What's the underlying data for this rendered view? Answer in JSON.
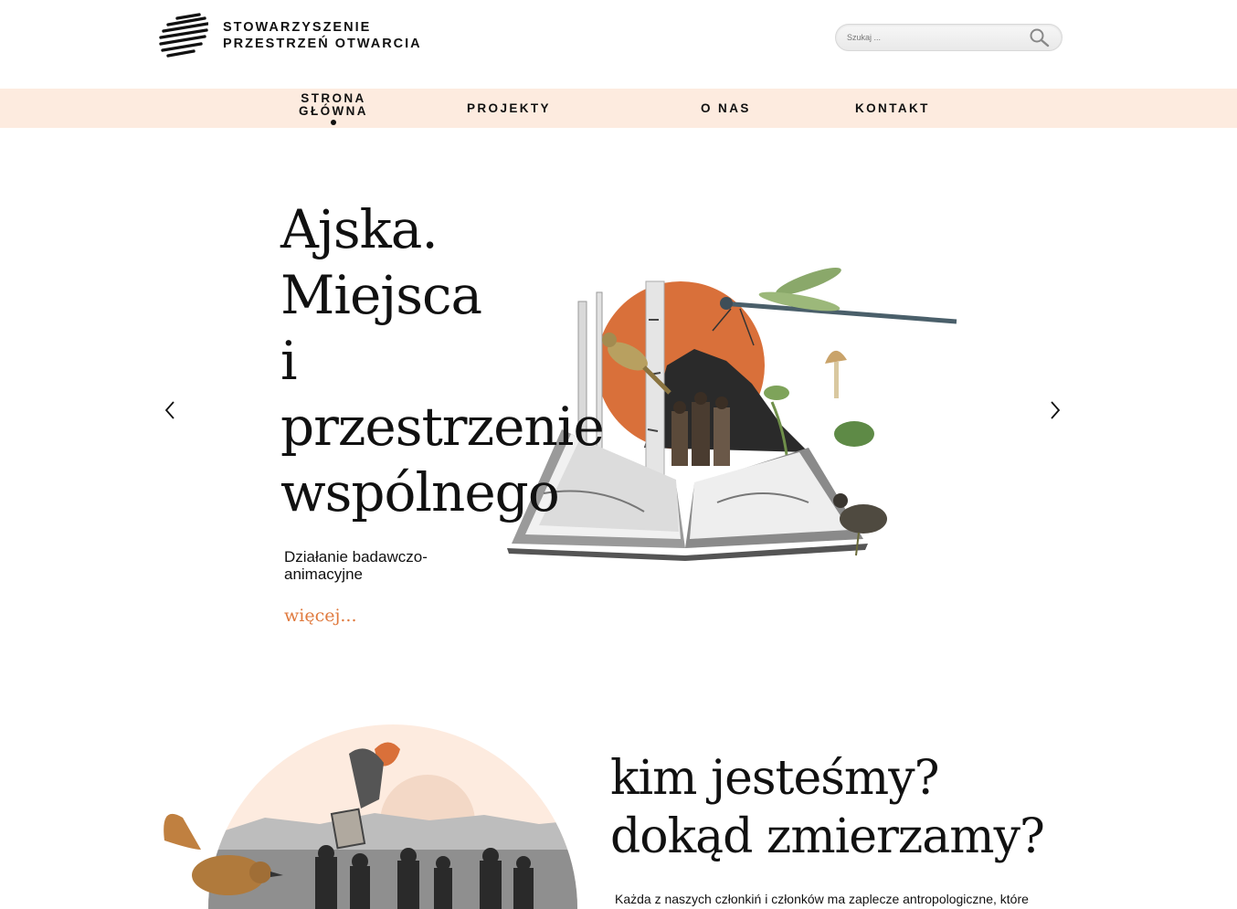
{
  "header": {
    "logo_line1": "STOWARZYSZENIE",
    "logo_line2": "PRZESTRZEŃ OTWARCIA",
    "search_placeholder": "Szukaj ..."
  },
  "nav": {
    "items": [
      {
        "label": "STRONA GŁÓWNA",
        "active": true
      },
      {
        "label": "PROJEKTY"
      },
      {
        "label": "O NAS"
      },
      {
        "label": "KONTAKT"
      }
    ]
  },
  "hero": {
    "title_lines": [
      "Ajska.",
      "Miejsca",
      "i",
      "przestrzenie",
      "wspólnego"
    ],
    "subtitle": "Działanie badawczo-animacyjne",
    "more_label": "więcej..."
  },
  "about": {
    "title_line1": "kim jesteśmy?",
    "title_line2": "dokąd zmierzamy?",
    "text": "Każda z naszych członkiń i członków ma zaplecze antropologiczne, które"
  },
  "colors": {
    "accent": "#e07a3e",
    "nav_bg": "#fdebdf",
    "text": "#111111"
  },
  "icons": [
    "logo-mark-icon",
    "search-icon",
    "chevron-left-icon",
    "chevron-right-icon"
  ]
}
